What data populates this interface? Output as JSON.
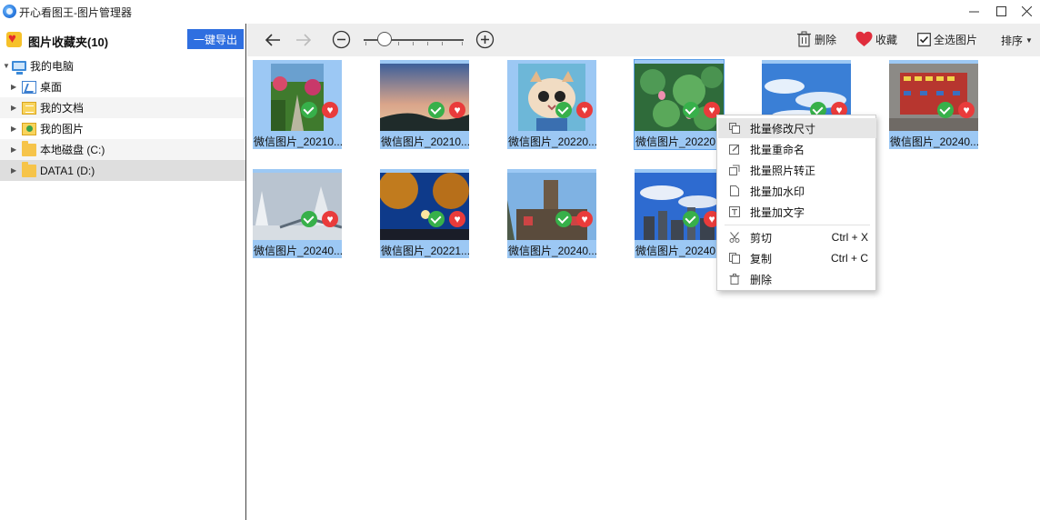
{
  "window": {
    "title": "开心看图王-图片管理器",
    "controls": [
      "minimize-icon",
      "maximize-icon",
      "close-icon"
    ]
  },
  "sidebar": {
    "header_title": "图片收藏夹(10)",
    "export_label": "一键导出",
    "tree": [
      {
        "label": "我的电脑",
        "icon": "computer-icon",
        "expanded": true
      },
      {
        "label": "桌面",
        "icon": "desktop-icon"
      },
      {
        "label": "我的文档",
        "icon": "documents-icon"
      },
      {
        "label": "我的图片",
        "icon": "pictures-icon"
      },
      {
        "label": "本地磁盘 (C:)",
        "icon": "folder-icon"
      },
      {
        "label": "DATA1 (D:)",
        "icon": "folder-icon",
        "selected": true
      }
    ]
  },
  "toolbar": {
    "delete_label": "删除",
    "favorite_label": "收藏",
    "select_all_label": "全选图片",
    "select_all_checked": true,
    "sort_label": "排序",
    "zoom_level": 0.2
  },
  "photos": [
    {
      "name": "微信图片_20210...",
      "checked": true,
      "favorite": true,
      "scene": "garden-path"
    },
    {
      "name": "微信图片_20210...",
      "checked": true,
      "favorite": true,
      "scene": "sunset-sky"
    },
    {
      "name": "微信图片_20220...",
      "checked": true,
      "favorite": true,
      "scene": "cat"
    },
    {
      "name": "微信图片_20220...",
      "checked": true,
      "favorite": true,
      "scene": "lotus-pond"
    },
    {
      "name": "",
      "checked": true,
      "favorite": true,
      "scene": "blue-sky-clouds"
    },
    {
      "name": "微信图片_20240...",
      "checked": true,
      "favorite": true,
      "scene": "red-signs-wall"
    },
    {
      "name": "微信图片_20240...",
      "checked": true,
      "favorite": true,
      "scene": "snow-trees"
    },
    {
      "name": "微信图片_20221...",
      "checked": true,
      "favorite": true,
      "scene": "night-trees"
    },
    {
      "name": "微信图片_20240...",
      "checked": true,
      "favorite": true,
      "scene": "city-building"
    },
    {
      "name": "微信图片_20240...",
      "checked": true,
      "favorite": true,
      "scene": "city-skyline"
    }
  ],
  "context_menu": {
    "items": [
      {
        "label": "批量修改尺寸",
        "icon": "resize-icon",
        "shortcut": ""
      },
      {
        "label": "批量重命名",
        "icon": "rename-icon",
        "shortcut": ""
      },
      {
        "label": "批量照片转正",
        "icon": "rotate-icon",
        "shortcut": ""
      },
      {
        "label": "批量加水印",
        "icon": "watermark-icon",
        "shortcut": ""
      },
      {
        "label": "批量加文字",
        "icon": "add-text-icon",
        "shortcut": ""
      },
      {
        "label": "剪切",
        "icon": "cut-icon",
        "shortcut": "Ctrl + X"
      },
      {
        "label": "复制",
        "icon": "copy-icon",
        "shortcut": "Ctrl + C"
      },
      {
        "label": "删除",
        "icon": "trash-icon",
        "shortcut": ""
      }
    ]
  },
  "colors": {
    "accent": "#2f6fe0",
    "selection": "#9cc8f4",
    "check_green": "#37b04a",
    "heart_red": "#e93b3b"
  }
}
